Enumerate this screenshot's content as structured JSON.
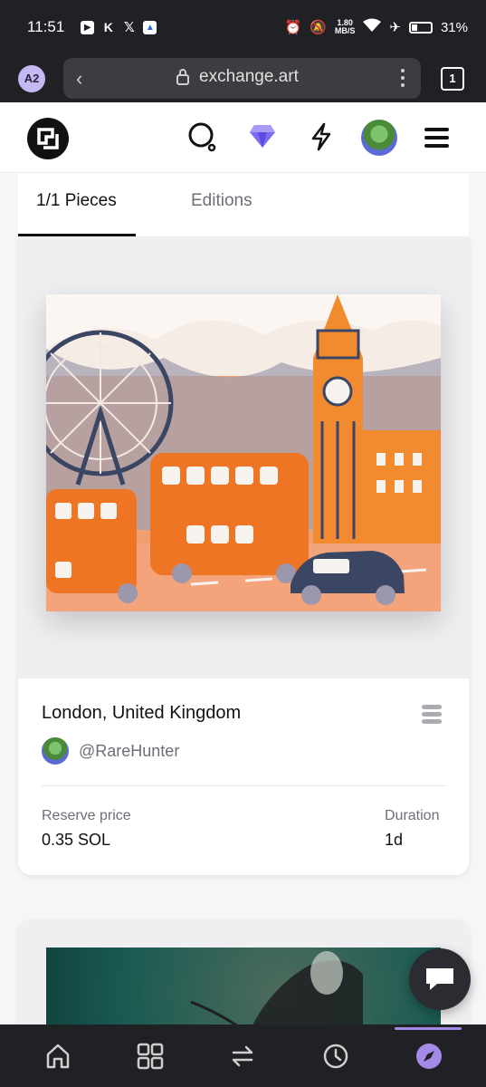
{
  "status_bar": {
    "time": "11:51",
    "net_speed_top": "1.80",
    "net_speed_bottom": "MB/S",
    "battery": "31%"
  },
  "browser": {
    "profile": "A2",
    "url": "exchange.art",
    "tab_count": "1"
  },
  "header": {
    "icons": [
      "search-icon",
      "diamond-icon",
      "lightning-icon",
      "avatar",
      "menu-icon"
    ]
  },
  "tabs": {
    "pieces": "1/1 Pieces",
    "editions": "Editions"
  },
  "listing": {
    "title": "London, United Kingdom",
    "creator": "@RareHunter",
    "reserve_label": "Reserve price",
    "reserve_value": "0.35 SOL",
    "duration_label": "Duration",
    "duration_value": "1d"
  },
  "bottom_nav": {
    "items": [
      "home-icon",
      "grid-icon",
      "swap-icon",
      "history-icon",
      "compass-icon"
    ],
    "active": "compass-icon"
  },
  "colors": {
    "accent": "#a48ae6",
    "art_orange": "#f08c3a",
    "dark": "#202124"
  }
}
